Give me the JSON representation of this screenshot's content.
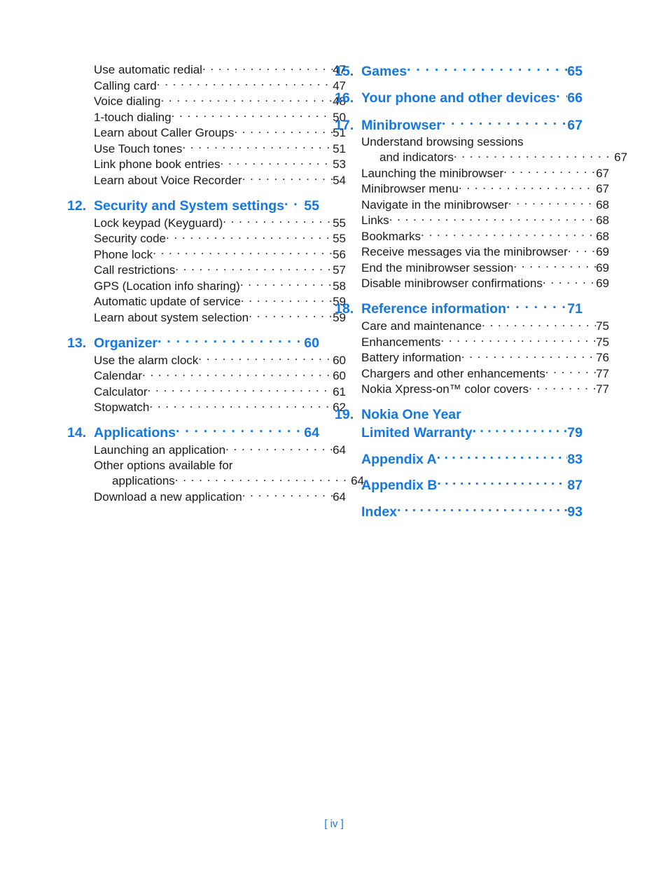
{
  "document": {
    "type": "table-of-contents",
    "footer_page_label": "[ iv ]"
  },
  "left_column": {
    "orphan_entries": [
      {
        "title": "Use automatic redial",
        "page": "47"
      },
      {
        "title": "Calling card",
        "page": "47"
      },
      {
        "title": "Voice dialing",
        "page": "48"
      },
      {
        "title": "1-touch dialing",
        "page": "50"
      },
      {
        "title": "Learn about Caller Groups",
        "page": "51"
      },
      {
        "title": "Use Touch tones",
        "page": "51"
      },
      {
        "title": "Link phone book entries",
        "page": "53"
      },
      {
        "title": "Learn about Voice Recorder",
        "page": "54"
      }
    ],
    "chapters": [
      {
        "number": "12.",
        "title": "Security and System settings",
        "page": "55",
        "entries": [
          {
            "title": "Lock keypad (Keyguard)",
            "page": "55"
          },
          {
            "title": "Security code",
            "page": "55"
          },
          {
            "title": "Phone lock",
            "page": "56"
          },
          {
            "title": "Call restrictions",
            "page": "57"
          },
          {
            "title": "GPS (Location info sharing)",
            "page": "58"
          },
          {
            "title": "Automatic update of service",
            "page": "59"
          },
          {
            "title": "Learn about system selection",
            "page": "59"
          }
        ]
      },
      {
        "number": "13.",
        "title": "Organizer",
        "page": "60",
        "entries": [
          {
            "title": "Use the alarm clock",
            "page": "60"
          },
          {
            "title": "Calendar",
            "page": "60"
          },
          {
            "title": "Calculator",
            "page": "61"
          },
          {
            "title": "Stopwatch",
            "page": "62"
          }
        ]
      },
      {
        "number": "14.",
        "title": "Applications",
        "page": "64",
        "entries": [
          {
            "title": "Launching an application",
            "page": "64"
          },
          {
            "title": "Other options available for",
            "wrapped_line": "applications",
            "page": "64"
          },
          {
            "title": "Download a new application",
            "page": "64"
          }
        ]
      }
    ]
  },
  "right_column": {
    "chapters": [
      {
        "number": "15.",
        "title": "Games",
        "page": "65",
        "entries": []
      },
      {
        "number": "16.",
        "title": "Your phone and other devices",
        "page": "66",
        "entries": []
      },
      {
        "number": "17.",
        "title": "Minibrowser",
        "page": "67",
        "entries": [
          {
            "title": "Understand browsing sessions",
            "wrapped_line": "and indicators",
            "page": "67"
          },
          {
            "title": "Launching the minibrowser",
            "page": "67"
          },
          {
            "title": "Minibrowser menu",
            "page": "67"
          },
          {
            "title": "Navigate in the minibrowser",
            "page": "68"
          },
          {
            "title": "Links",
            "page": "68"
          },
          {
            "title": "Bookmarks",
            "page": "68"
          },
          {
            "title": "Receive messages via the minibrowser",
            "page": "69"
          },
          {
            "title": "End the minibrowser session",
            "page": "69"
          },
          {
            "title": "Disable minibrowser confirmations",
            "page": "69"
          }
        ]
      },
      {
        "number": "18.",
        "title": "Reference information",
        "page": "71",
        "entries": [
          {
            "title": "Care and maintenance",
            "page": "75"
          },
          {
            "title": "Enhancements",
            "page": "75"
          },
          {
            "title": "Battery information",
            "page": "76"
          },
          {
            "title": "Chargers and other enhancements",
            "page": "77"
          },
          {
            "title": "Nokia Xpress-on™ color covers",
            "page": "77"
          }
        ]
      }
    ],
    "warranty_chapter": {
      "number": "19.",
      "title_line_1": "Nokia One Year",
      "title_line_2": "Limited Warranty",
      "page": "79"
    },
    "appendices": [
      {
        "title": "Appendix A",
        "page": "83"
      },
      {
        "title": "Appendix B",
        "page": "87"
      },
      {
        "title": "Index",
        "page": "93"
      }
    ]
  },
  "colors": {
    "accent_blue": "#1378E4",
    "body_text": "#1a1a1a",
    "background": "#ffffff"
  }
}
